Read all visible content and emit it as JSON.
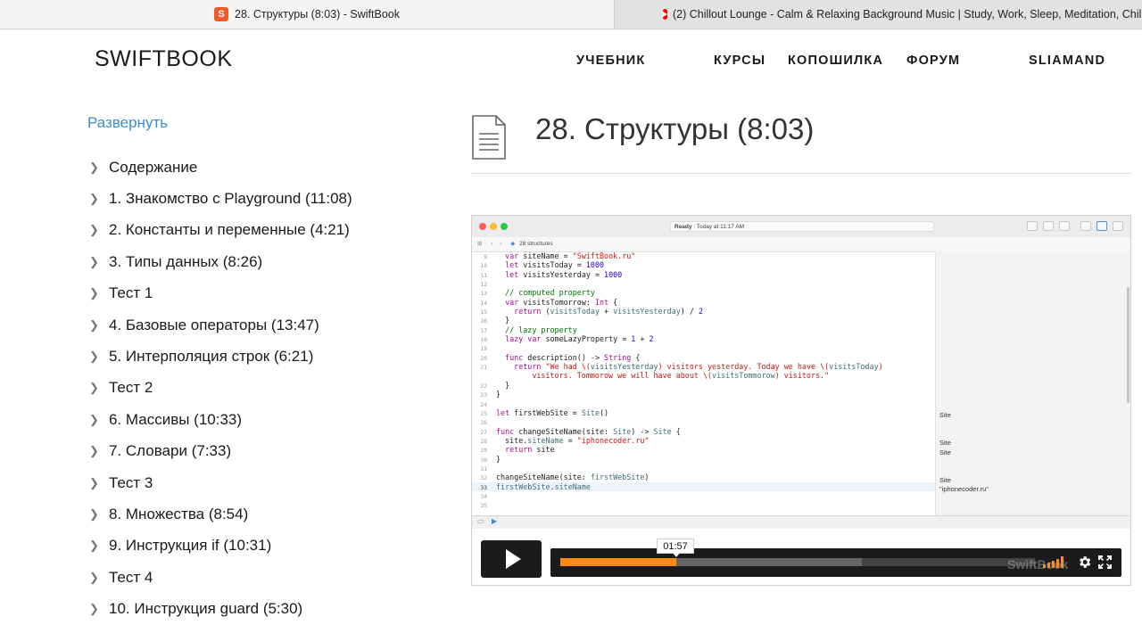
{
  "browser": {
    "tabs": [
      {
        "title": "28. Структуры (8:03) - SwiftBook",
        "favicon": "swiftbook-icon",
        "active": true
      },
      {
        "title": "(2) Chillout Lounge - Calm & Relaxing Background Music | Study, Work, Sleep, Meditation, Chill",
        "favicon": "youtube-icon",
        "active": false
      }
    ]
  },
  "header": {
    "logo": "SWIFTBOOK",
    "nav": [
      "УЧЕБНИК",
      "КУРСЫ",
      "КОПОШИЛКА",
      "ФОРУМ",
      "SLIAMAND"
    ]
  },
  "sidebar": {
    "expand_label": "Развернуть",
    "items": [
      "Содержание",
      "1. Знакомство с Playground (11:08)",
      "2. Константы и переменные (4:21)",
      "3. Типы данных (8:26)",
      "Тест 1",
      "4. Базовые операторы (13:47)",
      "5. Интерполяция строк (6:21)",
      "Тест 2",
      "6. Массивы (10:33)",
      "7. Словари (7:33)",
      "Тест 3",
      "8. Множества (8:54)",
      "9. Инструкция if (10:31)",
      "Тест 4",
      "10. Инструкция guard (5:30)"
    ]
  },
  "lesson": {
    "title": "28. Структуры (8:03)"
  },
  "xcode": {
    "status": "Ready",
    "status_time": "Today at 11:17 AM",
    "file_name": "28 structures",
    "results": [
      {
        "line": 25,
        "text": "Site"
      },
      {
        "line": 28,
        "text": "Site"
      },
      {
        "line": 29,
        "text": "Site"
      },
      {
        "line": 32,
        "text": "Site"
      },
      {
        "line": 33,
        "text": "\"iphonecoder.ru\""
      }
    ]
  },
  "player": {
    "current_time": "01:57",
    "progress": 0.245,
    "buffered": 0.635,
    "watermark": "SwiftBook"
  },
  "colors": {
    "accent_link": "#3a8fd0",
    "progress": "#ff8a14"
  }
}
